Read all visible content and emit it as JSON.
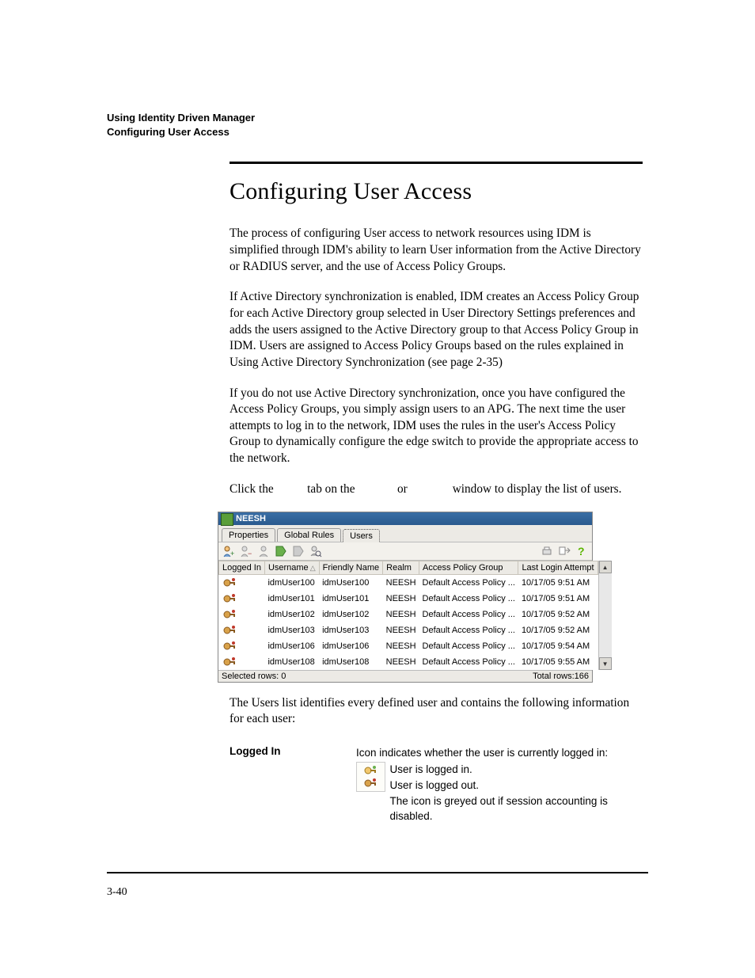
{
  "header": {
    "line1": "Using Identity Driven Manager",
    "line2": "Configuring User Access"
  },
  "title": "Configuring User Access",
  "paragraphs": {
    "p1": "The process of configuring User access to network resources using IDM is simplified through IDM's ability to learn User information from the Active Directory or RADIUS server, and the use of Access Policy Groups.",
    "p2": "If Active Directory synchronization is enabled, IDM creates an Access Policy Group for each Active Directory group selected in User Directory Settings preferences and adds the users assigned to the Active Directory group to that Access Policy Group in IDM. Users are assigned to Access Policy Groups based on the rules explained in Using Active Directory Synchronization (see page 2-35)",
    "p3": "If you do not use Active Directory synchronization, once you have configured the Access Policy Groups, you simply assign users to an APG. The next time the user attempts to log in to the network, IDM uses the rules in the user's Access Policy Group to dynamically configure the edge switch to provide the appropriate access to the network.",
    "p4a": "Click the ",
    "p4b": " tab on the ",
    "p4c": " or ",
    "p4d": " window to display the list of users."
  },
  "window": {
    "title": "NEESH",
    "tabs": [
      "Properties",
      "Global Rules",
      "Users"
    ],
    "active_tab": 2,
    "columns": [
      "Logged In",
      "Username",
      "Friendly Name",
      "Realm",
      "Access Policy Group",
      "Last Login Attempt"
    ],
    "rows": [
      {
        "username": "idmUser100",
        "friendly": "idmUser100",
        "realm": "NEESH",
        "apg": "Default Access Policy ...",
        "last": "10/17/05 9:51 AM"
      },
      {
        "username": "idmUser101",
        "friendly": "idmUser101",
        "realm": "NEESH",
        "apg": "Default Access Policy ...",
        "last": "10/17/05 9:51 AM"
      },
      {
        "username": "idmUser102",
        "friendly": "idmUser102",
        "realm": "NEESH",
        "apg": "Default Access Policy ...",
        "last": "10/17/05 9:52 AM"
      },
      {
        "username": "idmUser103",
        "friendly": "idmUser103",
        "realm": "NEESH",
        "apg": "Default Access Policy ...",
        "last": "10/17/05 9:52 AM"
      },
      {
        "username": "idmUser106",
        "friendly": "idmUser106",
        "realm": "NEESH",
        "apg": "Default Access Policy ...",
        "last": "10/17/05 9:54 AM"
      },
      {
        "username": "idmUser108",
        "friendly": "idmUser108",
        "realm": "NEESH",
        "apg": "Default Access Policy ...",
        "last": "10/17/05 9:55 AM"
      }
    ],
    "status_left": "Selected rows: 0",
    "status_right": "Total rows:166"
  },
  "after_image": "The Users list identifies every defined user and contains the following information for each user:",
  "definition": {
    "term": "Logged In",
    "line1": "Icon indicates whether the user is currently logged in:",
    "line2": "User is logged in.",
    "line3": "User is logged out.",
    "line4": "The icon is greyed out if session accounting is disabled."
  },
  "page_number": "3-40"
}
